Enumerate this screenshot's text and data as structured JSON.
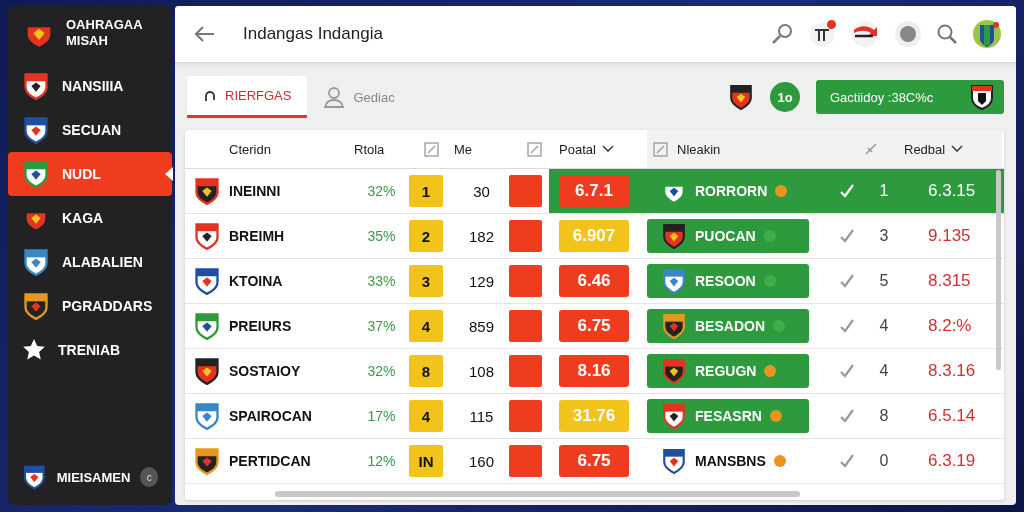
{
  "sidebar": {
    "brand_lines": [
      "OAHRAGAA",
      "MISAH"
    ],
    "items": [
      {
        "label": "NANSIIIA",
        "kind": "crest",
        "selected": false
      },
      {
        "label": "SECUAN",
        "kind": "crest",
        "selected": false
      },
      {
        "label": "NUDL",
        "kind": "crest",
        "selected": true
      },
      {
        "label": "KAGA",
        "kind": "crest",
        "selected": false
      },
      {
        "label": "ALABALIEN",
        "kind": "crest",
        "selected": false
      },
      {
        "label": "PGRADDARS",
        "kind": "crest",
        "selected": false
      },
      {
        "label": "TRENIAB",
        "kind": "star",
        "selected": false
      }
    ],
    "footer": {
      "label": "MIEISAMEN",
      "badge": "c"
    }
  },
  "header": {
    "title": "Indangas Indangia"
  },
  "tabs": [
    {
      "label": "RIERFGAS",
      "selected": true
    },
    {
      "label": "Gediac",
      "selected": false
    }
  ],
  "summary": {
    "count": "1o",
    "button": "Gactiidoy :38C%c"
  },
  "table": {
    "columns": [
      {
        "label": "Cteridn",
        "kind": "text"
      },
      {
        "label": "Rtola",
        "kind": "text"
      },
      {
        "kind": "toggle"
      },
      {
        "label": "Me",
        "kind": "text"
      },
      {
        "kind": "toggle"
      },
      {
        "label": "Poatal",
        "kind": "sort"
      },
      {
        "kind": "toggle"
      },
      {
        "label": "Nleakin",
        "kind": "text"
      },
      {
        "kind": "edit"
      },
      {
        "label": "Redbal",
        "kind": "sort"
      }
    ],
    "rows": [
      {
        "team": "INEINNI",
        "share": "32%",
        "rank": "1",
        "played": "30",
        "score": {
          "text": "6.7.1",
          "color": "#f03c1e"
        },
        "opponent": "RORRORN",
        "opponent_highlighted": false,
        "opponent_badge": {
          "color": "#e8961e"
        },
        "count": "1",
        "value": "6.3.15",
        "selected": true
      },
      {
        "team": "BREIMH",
        "share": "35%",
        "rank": "2",
        "played": "182",
        "score": {
          "text": "6.907",
          "color": "#f2c31b"
        },
        "opponent": "PUOCAN",
        "opponent_highlighted": true,
        "opponent_badge": {
          "color": "#3fae4a"
        },
        "count": "3",
        "value": "9.135",
        "selected": false
      },
      {
        "team": "KTOINA",
        "share": "33%",
        "rank": "3",
        "played": "129",
        "score": {
          "text": "6.46",
          "color": "#f03c1e"
        },
        "opponent": "RESOON",
        "opponent_highlighted": true,
        "opponent_badge": {
          "color": "#3fae4a"
        },
        "count": "5",
        "value": "8.315",
        "selected": false
      },
      {
        "team": "PREIURS",
        "share": "37%",
        "rank": "4",
        "played": "859",
        "score": {
          "text": "6.75",
          "color": "#f03c1e"
        },
        "opponent": "BESADON",
        "opponent_highlighted": true,
        "opponent_badge": {
          "color": "#3fae4a"
        },
        "count": "4",
        "value": "8.2:%",
        "selected": false
      },
      {
        "team": "SOSTAIOY",
        "share": "32%",
        "rank": "8",
        "played": "108",
        "score": {
          "text": "8.16",
          "color": "#f03c1e"
        },
        "opponent": "REGUGN",
        "opponent_highlighted": true,
        "opponent_badge": {
          "color": "#e8961e"
        },
        "count": "4",
        "value": "8.3.16",
        "selected": false
      },
      {
        "team": "SPAIROCAN",
        "share": "17%",
        "rank": "4",
        "played": "115",
        "score": {
          "text": "31.76",
          "color": "#f2c31b"
        },
        "opponent": "FESASRN",
        "opponent_highlighted": true,
        "opponent_badge": {
          "color": "#e8961e"
        },
        "count": "8",
        "value": "6.5.14",
        "selected": false
      },
      {
        "team": "PERTIDCAN",
        "share": "12%",
        "rank": "IN",
        "played": "160",
        "score": {
          "text": "6.75",
          "color": "#f03c1e"
        },
        "opponent": "MANSBNS",
        "opponent_highlighted": false,
        "opponent_badge": {
          "color": "#e8961e"
        },
        "count": "0",
        "value": "6.3.19",
        "selected": false
      }
    ]
  }
}
